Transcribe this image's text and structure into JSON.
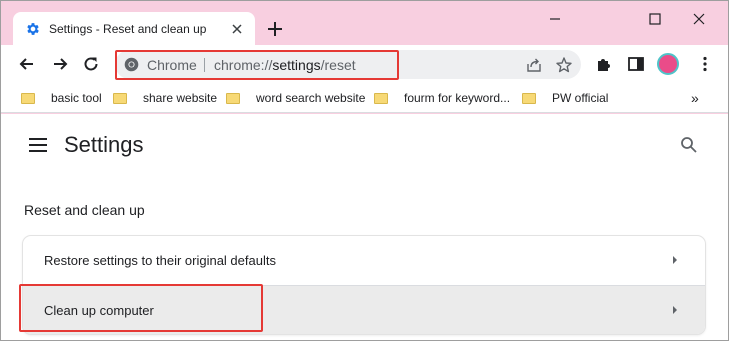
{
  "tab": {
    "title": "Settings - Reset and clean up"
  },
  "omnibox": {
    "site_label": "Chrome",
    "url_prefix": "chrome://",
    "url_strong": "settings",
    "url_suffix": "/reset"
  },
  "bookmarks": [
    {
      "label": "basic tool"
    },
    {
      "label": "share website"
    },
    {
      "label": "word search website"
    },
    {
      "label": "fourm for keyword..."
    },
    {
      "label": "PW official"
    }
  ],
  "bookmarks_more": "»",
  "page": {
    "title": "Settings"
  },
  "section": {
    "title": "Reset and clean up"
  },
  "rows": [
    {
      "label": "Restore settings to their original defaults"
    },
    {
      "label": "Clean up computer"
    }
  ],
  "colors": {
    "frame": "#f8cfe0",
    "highlight": "#e53935",
    "accent": "#1a73e8"
  },
  "icons": [
    "settings-gear-icon",
    "close-icon",
    "plus-icon",
    "minimize-icon",
    "maximize-icon",
    "window-close-icon",
    "back-arrow-icon",
    "forward-arrow-icon",
    "reload-icon",
    "chrome-logo-icon",
    "share-icon",
    "star-icon",
    "extensions-puzzle-icon",
    "side-panel-icon",
    "avatar",
    "more-vert-icon",
    "folder-icon",
    "hamburger-menu-icon",
    "search-icon",
    "arrow-right-icon"
  ]
}
